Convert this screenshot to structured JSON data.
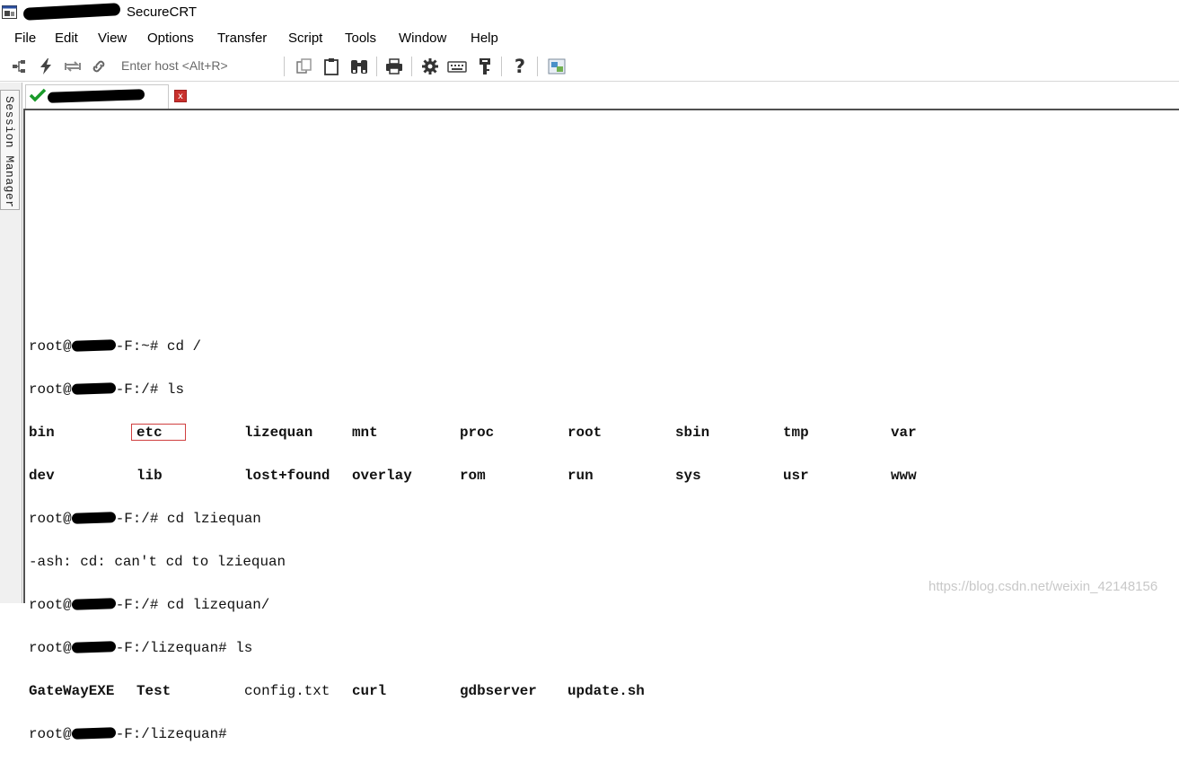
{
  "window": {
    "title": "SecureCRT"
  },
  "menu": [
    "File",
    "Edit",
    "View",
    "Options",
    "Transfer",
    "Script",
    "Tools",
    "Window",
    "Help"
  ],
  "toolbar": {
    "host_placeholder": "Enter host <Alt+R>",
    "icons": [
      "connect-tree-icon",
      "quick-connect-lightning-icon",
      "reconnect-icon",
      "disconnect-link-icon",
      "copy-icon",
      "paste-icon",
      "find-binoculars-icon",
      "print-icon",
      "settings-gear-icon",
      "keymap-icon",
      "key-icon",
      "help-icon",
      "image-icon"
    ]
  },
  "tab": {
    "status_icon": "check-icon",
    "close_label": "x"
  },
  "session_manager": {
    "label": "Session Manager"
  },
  "terminal": {
    "cmd1": {
      "prefix": "root@",
      "suffix": "-F:~# cd /"
    },
    "cmd2": {
      "prefix": "root@",
      "suffix": "-F:/# ls"
    },
    "ls_root_row1": [
      "bin",
      "etc",
      "lizequan",
      "mnt",
      "proc",
      "root",
      "sbin",
      "tmp",
      "var"
    ],
    "ls_root_row2": [
      "dev",
      "lib",
      "lost+found",
      "overlay",
      "rom",
      "run",
      "sys",
      "usr",
      "www"
    ],
    "cmd3": {
      "prefix": "root@",
      "suffix": "-F:/# cd lziequan"
    },
    "error": "-ash: cd: can't cd to lziequan",
    "cmd4": {
      "prefix": "root@",
      "suffix": "-F:/# cd lizequan/"
    },
    "cmd5": {
      "prefix": "root@",
      "suffix": "-F:/lizequan# ls"
    },
    "ls_lizequan": [
      {
        "name": "GateWayEXE",
        "bold": true
      },
      {
        "name": "Test",
        "bold": true
      },
      {
        "name": "config.txt",
        "bold": false
      },
      {
        "name": "curl",
        "bold": true
      },
      {
        "name": "gdbserver",
        "bold": true
      },
      {
        "name": "update.sh",
        "bold": true
      }
    ],
    "cmd6": {
      "prefix": "root@",
      "suffix": "-F:/lizequan#"
    }
  },
  "watermark": "https://blog.csdn.net/weixin_42148156"
}
